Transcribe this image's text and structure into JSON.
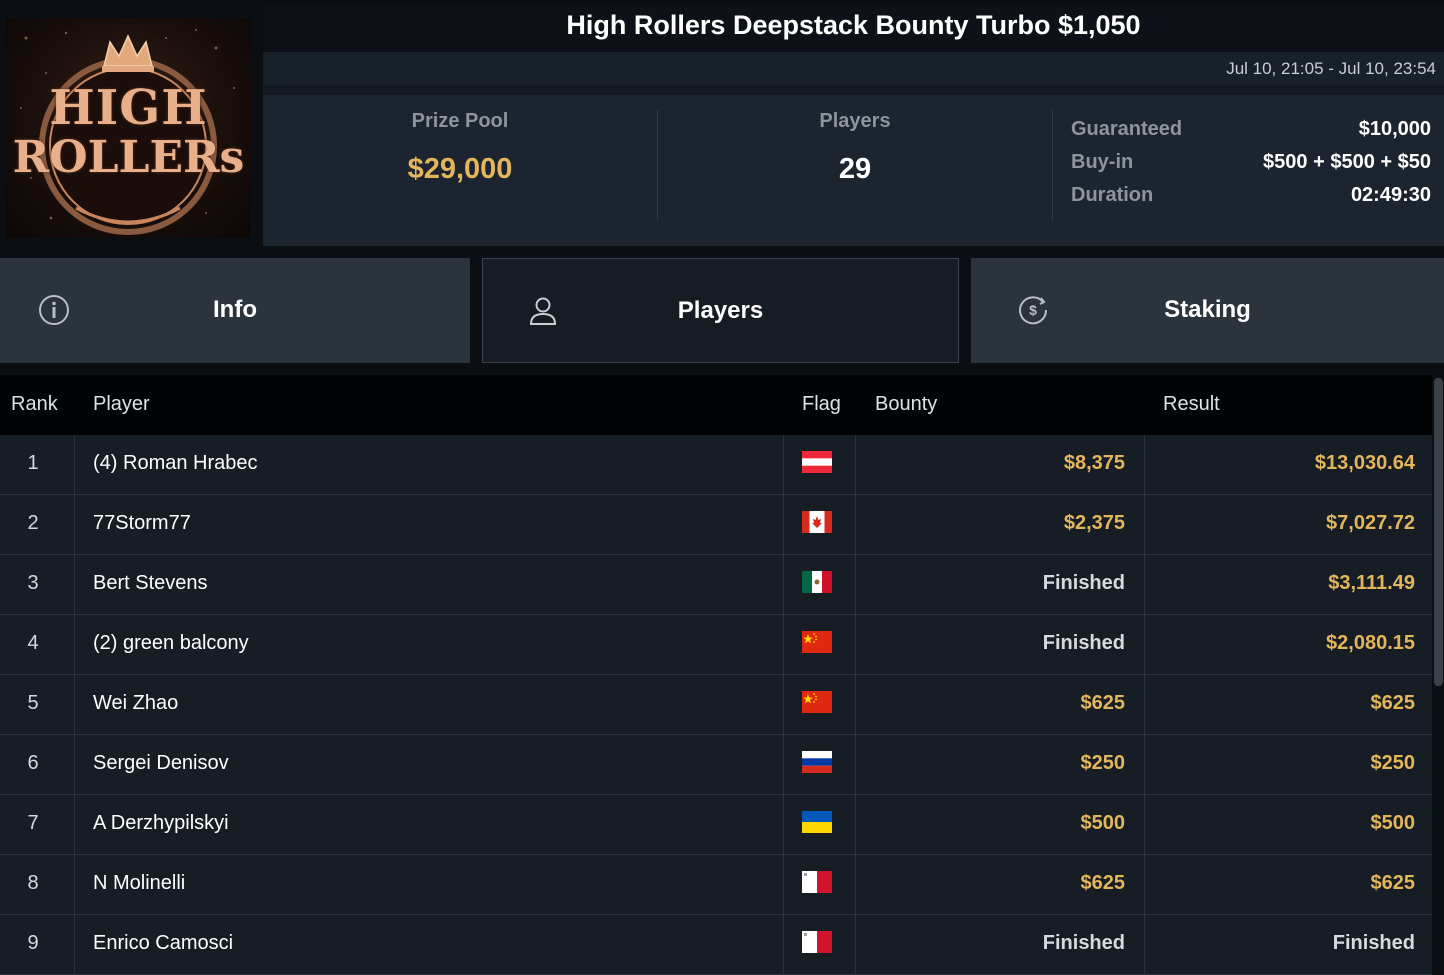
{
  "logo": {
    "line1": "HIGH",
    "line2": "ROLLERs"
  },
  "header": {
    "title": "High Rollers Deepstack Bounty Turbo $1,050",
    "dates": "Jul 10, 21:05 - Jul 10, 23:54"
  },
  "stats": {
    "prize_pool_label": "Prize Pool",
    "prize_pool_value": "$29,000",
    "players_label": "Players",
    "players_value": "29"
  },
  "details": [
    {
      "label": "Guaranteed",
      "value": "$10,000"
    },
    {
      "label": "Buy-in",
      "value": "$500 + $500 + $50"
    },
    {
      "label": "Duration",
      "value": "02:49:30"
    }
  ],
  "tabs": [
    {
      "label": "Info",
      "icon": "info-icon",
      "active": false
    },
    {
      "label": "Players",
      "icon": "user-icon",
      "active": true
    },
    {
      "label": "Staking",
      "icon": "dollar-coin-icon",
      "active": false
    }
  ],
  "table": {
    "headers": {
      "rank": "Rank",
      "player": "Player",
      "flag": "Flag",
      "bounty": "Bounty",
      "result": "Result"
    },
    "rows": [
      {
        "rank": "1",
        "player": "(4) Roman Hrabec",
        "flag": "austria",
        "bounty": "$8,375",
        "result": "$13,030.64"
      },
      {
        "rank": "2",
        "player": "77Storm77",
        "flag": "canada",
        "bounty": "$2,375",
        "result": "$7,027.72"
      },
      {
        "rank": "3",
        "player": "Bert Stevens",
        "flag": "mexico",
        "bounty": "Finished",
        "result": "$3,111.49"
      },
      {
        "rank": "4",
        "player": "(2) green balcony",
        "flag": "china",
        "bounty": "Finished",
        "result": "$2,080.15"
      },
      {
        "rank": "5",
        "player": "Wei Zhao",
        "flag": "china",
        "bounty": "$625",
        "result": "$625"
      },
      {
        "rank": "6",
        "player": "Sergei Denisov",
        "flag": "russia",
        "bounty": "$250",
        "result": "$250"
      },
      {
        "rank": "7",
        "player": "A Derzhypilskyi",
        "flag": "ukraine",
        "bounty": "$500",
        "result": "$500"
      },
      {
        "rank": "8",
        "player": "N Molinelli",
        "flag": "malta",
        "bounty": "$625",
        "result": "$625"
      },
      {
        "rank": "9",
        "player": "Enrico Camosci",
        "flag": "malta",
        "bounty": "Finished",
        "result": "Finished"
      }
    ]
  },
  "colors": {
    "gold": "#e3b55c",
    "background": "#0b0e12",
    "panel": "#1c2430"
  }
}
